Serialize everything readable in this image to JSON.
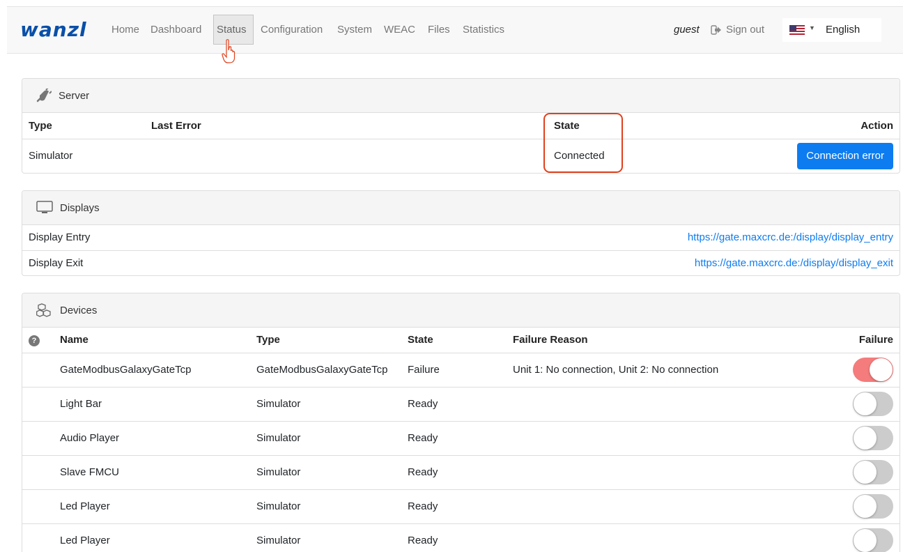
{
  "brand": {
    "logo_text": "wanzl",
    "brand_color": "#0a4fa8"
  },
  "nav": {
    "items": [
      {
        "label": "Home"
      },
      {
        "label": "Dashboard"
      },
      {
        "label": "Status"
      },
      {
        "label": "Configuration"
      },
      {
        "label": "System"
      },
      {
        "label": "WEAC"
      },
      {
        "label": "Files"
      },
      {
        "label": "Statistics"
      }
    ],
    "active": "Status",
    "user": "guest",
    "signout_label": "Sign out",
    "language": "English"
  },
  "server": {
    "title": "Server",
    "columns": {
      "type": "Type",
      "last_error": "Last Error",
      "state": "State",
      "action": "Action"
    },
    "row": {
      "type": "Simulator",
      "last_error": "",
      "state": "Connected",
      "action_label": "Connection error"
    }
  },
  "displays": {
    "title": "Displays",
    "rows": [
      {
        "name": "Display Entry",
        "url": "https://gate.maxcrc.de:/display/display_entry"
      },
      {
        "name": "Display Exit",
        "url": "https://gate.maxcrc.de:/display/display_exit"
      }
    ]
  },
  "devices": {
    "title": "Devices",
    "columns": {
      "name": "Name",
      "type": "Type",
      "state": "State",
      "failure_reason": "Failure Reason",
      "failure": "Failure"
    },
    "rows": [
      {
        "name": "GateModbusGalaxyGateTcp",
        "type": "GateModbusGalaxyGateTcp",
        "state": "Failure",
        "failure_reason": "Unit 1: No connection, Unit 2: No connection",
        "failure": true
      },
      {
        "name": "Light Bar",
        "type": "Simulator",
        "state": "Ready",
        "failure_reason": "",
        "failure": false
      },
      {
        "name": "Audio Player",
        "type": "Simulator",
        "state": "Ready",
        "failure_reason": "",
        "failure": false
      },
      {
        "name": "Slave FMCU",
        "type": "Simulator",
        "state": "Ready",
        "failure_reason": "",
        "failure": false
      },
      {
        "name": "Led Player",
        "type": "Simulator",
        "state": "Ready",
        "failure_reason": "",
        "failure": false
      },
      {
        "name": "Led Player",
        "type": "Simulator",
        "state": "Ready",
        "failure_reason": "",
        "failure": false
      }
    ]
  },
  "colors": {
    "accent": "#0d7cf0",
    "highlight": "#e0401c",
    "failure_toggle": "#f47c7c"
  }
}
